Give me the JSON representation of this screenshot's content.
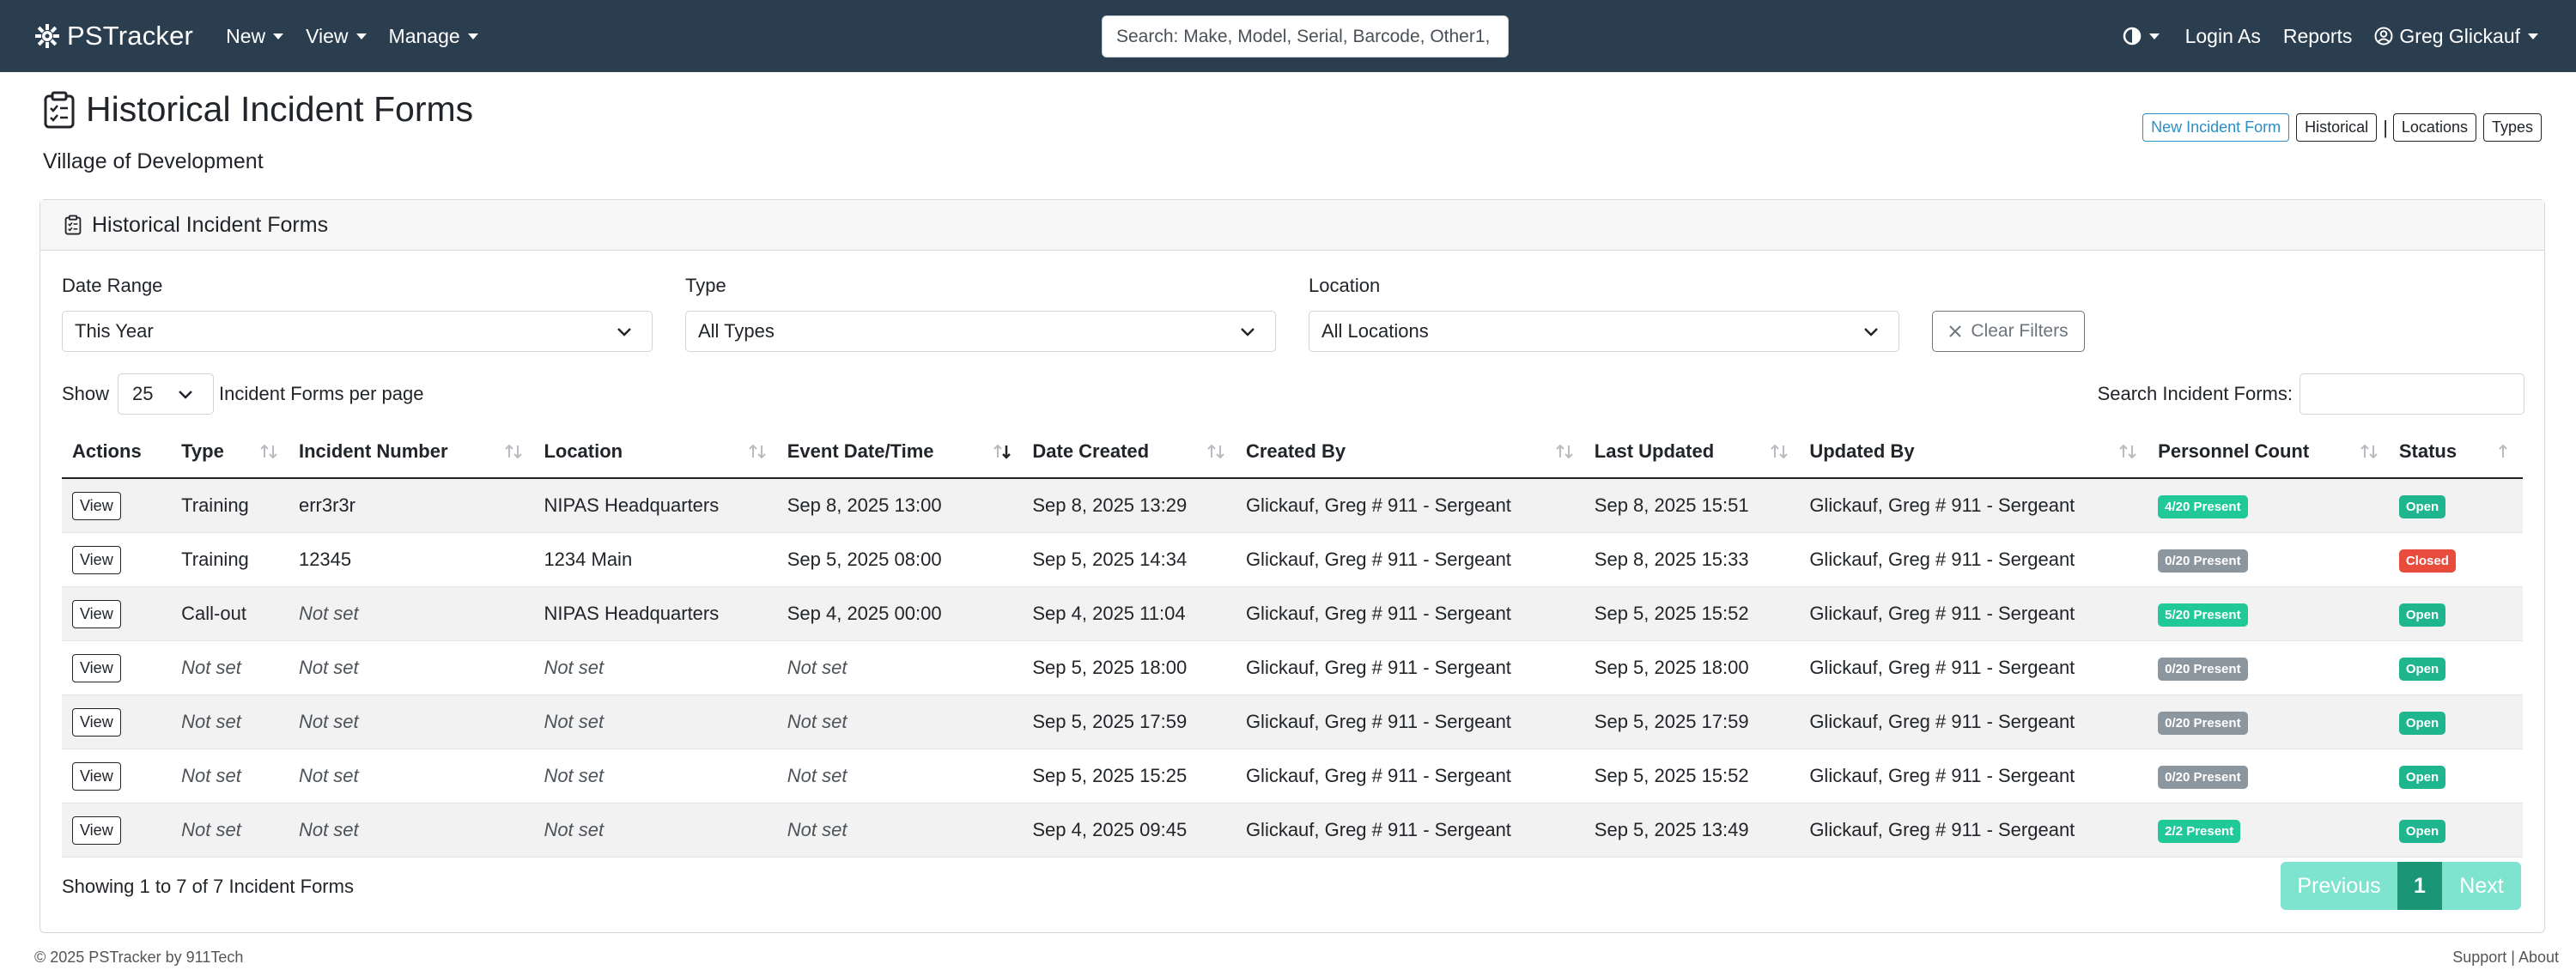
{
  "navbar": {
    "brand": "PSTracker",
    "menus": [
      {
        "label": "New"
      },
      {
        "label": "View"
      },
      {
        "label": "Manage"
      }
    ],
    "search_placeholder": "Search: Make, Model, Serial, Barcode, Other1,",
    "login_as": "Login As",
    "reports": "Reports",
    "user": "Greg Glickauf"
  },
  "header": {
    "title": "Historical Incident Forms",
    "subtitle": "Village of Development",
    "buttons": {
      "new_form": "New Incident Form",
      "historical": "Historical",
      "separator": "|",
      "locations": "Locations",
      "types": "Types"
    }
  },
  "card": {
    "title": "Historical Incident Forms",
    "filters": {
      "date_range": {
        "label": "Date Range",
        "value": "This Year"
      },
      "type": {
        "label": "Type",
        "value": "All Types"
      },
      "location": {
        "label": "Location",
        "value": "All Locations"
      },
      "clear": "Clear Filters"
    },
    "show_label": "Show",
    "page_size": "25",
    "per_page_label": "Incident Forms per page",
    "search_label": "Search Incident Forms:"
  },
  "table": {
    "columns": [
      "Actions",
      "Type",
      "Incident Number",
      "Location",
      "Event Date/Time",
      "Date Created",
      "Created By",
      "Last Updated",
      "Updated By",
      "Personnel Count",
      "Status"
    ],
    "view_label": "View",
    "rows": [
      {
        "type": "Training",
        "number": "err3r3r",
        "location": "NIPAS Headquarters",
        "event": "Sep 8, 2025 13:00",
        "created": "Sep 8, 2025 13:29",
        "created_by": "Glickauf, Greg # 911 - Sergeant",
        "updated": "Sep 8, 2025 15:51",
        "updated_by": "Glickauf, Greg # 911 - Sergeant",
        "personnel": "4/20 Present",
        "status": "Open"
      },
      {
        "type": "Training",
        "number": "12345",
        "location": "1234 Main",
        "event": "Sep 5, 2025 08:00",
        "created": "Sep 5, 2025 14:34",
        "created_by": "Glickauf, Greg # 911 - Sergeant",
        "updated": "Sep 8, 2025 15:33",
        "updated_by": "Glickauf, Greg # 911 - Sergeant",
        "personnel": "0/20 Present",
        "status": "Closed"
      },
      {
        "type": "Call-out",
        "number": "Not set",
        "location": "NIPAS Headquarters",
        "event": "Sep 4, 2025 00:00",
        "created": "Sep 4, 2025 11:04",
        "created_by": "Glickauf, Greg # 911 - Sergeant",
        "updated": "Sep 5, 2025 15:52",
        "updated_by": "Glickauf, Greg # 911 - Sergeant",
        "personnel": "5/20 Present",
        "status": "Open"
      },
      {
        "type": "Not set",
        "number": "Not set",
        "location": "Not set",
        "event": "Not set",
        "created": "Sep 5, 2025 18:00",
        "created_by": "Glickauf, Greg # 911 - Sergeant",
        "updated": "Sep 5, 2025 18:00",
        "updated_by": "Glickauf, Greg # 911 - Sergeant",
        "personnel": "0/20 Present",
        "status": "Open"
      },
      {
        "type": "Not set",
        "number": "Not set",
        "location": "Not set",
        "event": "Not set",
        "created": "Sep 5, 2025 17:59",
        "created_by": "Glickauf, Greg # 911 - Sergeant",
        "updated": "Sep 5, 2025 17:59",
        "updated_by": "Glickauf, Greg # 911 - Sergeant",
        "personnel": "0/20 Present",
        "status": "Open"
      },
      {
        "type": "Not set",
        "number": "Not set",
        "location": "Not set",
        "event": "Not set",
        "created": "Sep 5, 2025 15:25",
        "created_by": "Glickauf, Greg # 911 - Sergeant",
        "updated": "Sep 5, 2025 15:52",
        "updated_by": "Glickauf, Greg # 911 - Sergeant",
        "personnel": "0/20 Present",
        "status": "Open"
      },
      {
        "type": "Not set",
        "number": "Not set",
        "location": "Not set",
        "event": "Not set",
        "created": "Sep 4, 2025 09:45",
        "created_by": "Glickauf, Greg # 911 - Sergeant",
        "updated": "Sep 5, 2025 13:49",
        "updated_by": "Glickauf, Greg # 911 - Sergeant",
        "personnel": "2/2 Present",
        "status": "Open"
      }
    ]
  },
  "footer": {
    "showing": "Showing 1 to 7 of 7 Incident Forms",
    "previous": "Previous",
    "page": "1",
    "next": "Next",
    "copyright": "© 2025 PSTracker by 911Tech",
    "links": "Support | About"
  },
  "colors": {
    "navbar": "#2b3e50",
    "primary": "#2b8fc5",
    "badge_present": "#20c997",
    "badge_empty": "#8c969e",
    "badge_open": "#1fb58f",
    "badge_closed": "#e74c3c",
    "pager_light": "#7ee3cf",
    "pager_active": "#1a9676"
  }
}
